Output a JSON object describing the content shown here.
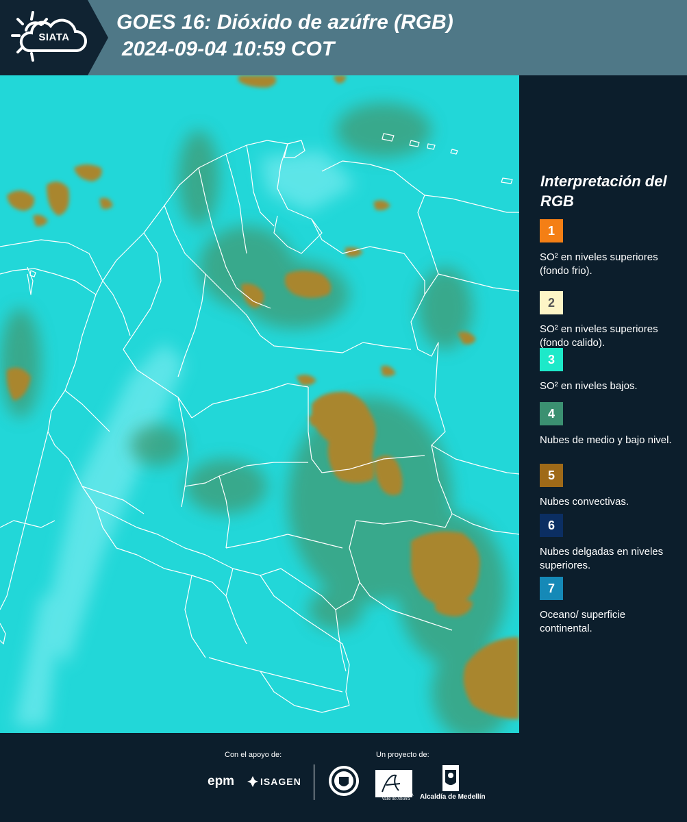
{
  "header": {
    "logo_text": "SIATA",
    "title": "GOES 16: Dióxido de azúfre (RGB)",
    "subtitle": "2024-09-04 10:59 COT"
  },
  "legend": {
    "title": "Interpretación del RGB",
    "items": [
      {
        "number": "1",
        "color": "#f47f15",
        "text": "SO² en niveles superiores (fondo frio)."
      },
      {
        "number": "2",
        "color": "#fdf5c6",
        "text": "SO² en niveles superiores (fondo calido)."
      },
      {
        "number": "3",
        "color": "#1de9c9",
        "text": "SO² en niveles bajos."
      },
      {
        "number": "4",
        "color": "#3b9071",
        "text": "Nubes de medio y bajo nivel."
      },
      {
        "number": "5",
        "color": "#9f6a18",
        "text": "Nubes convectivas."
      },
      {
        "number": "6",
        "color": "#0b2e62",
        "text": "Nubes delgadas en niveles superiores."
      },
      {
        "number": "7",
        "color": "#1589b7",
        "text": "Oceano/ superficie continental."
      }
    ]
  },
  "footer": {
    "support_label": "Con el apoyo de:",
    "project_label": "Un proyecto de:",
    "sponsors": [
      "epm",
      "ISAGEN"
    ],
    "partners": [
      "Área Metropolitana Valle de Aburrá",
      "Alcaldía de Medellín"
    ],
    "area_text": "METROPOLITANA Valle de Aburrá",
    "alcaldia_text": "Alcaldía de Medellín"
  },
  "map": {
    "background_color": "#22d7d8",
    "border_color": "#ffffff",
    "convective_color": "#a9862f",
    "midlevel_color": "#3f9a73"
  }
}
